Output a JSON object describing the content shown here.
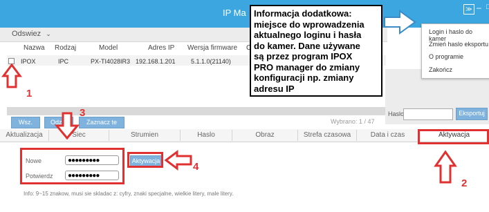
{
  "window": {
    "title": "IP Ma",
    "menu_icon": "chevron-down-double-icon",
    "minimize_glyph": "–",
    "maximize_glyph": "□"
  },
  "toolbar": {
    "refresh_label": "Odswiez"
  },
  "table": {
    "headers": [
      "Nazwa",
      "Rodzaj",
      "Model",
      "Adres IP",
      "Wersja firmware",
      "C"
    ],
    "rows": [
      {
        "name": "IPOX",
        "type": "IPC",
        "model": "PX-TI4028IR3",
        "ip": "192.168.1.201",
        "firmware": "5.1.1.0(21140)"
      }
    ]
  },
  "buttons": {
    "all": "Wsz.",
    "deselect": "Odzn.",
    "select_same": "Zaznacz te same"
  },
  "selection_hint": "Wybrano: 1 / 47",
  "password_label": "Haslo",
  "export_button": "Eksportuj",
  "tabs": [
    "Aktualizacja",
    "Siec",
    "Strumien",
    "Haslo",
    "Obraz",
    "Strefa czasowa",
    "Data i czas",
    "Aktywacja"
  ],
  "activation": {
    "new_label": "Nowe",
    "confirm_label": "Potwierdz",
    "new_value": "●●●●●●●●●",
    "confirm_value": "●●●●●●●●●",
    "button": "Aktywacja",
    "info": "Info: 9~15 znakow, musi sie skladac z: cyfry, znaki specjalne, wielkie litery, male litery."
  },
  "context_menu": {
    "items": [
      "Login i haslo do kamer",
      "Zmień haslo eksportu",
      "O programie",
      "Zakończ"
    ]
  },
  "callout": {
    "lines": [
      "Informacja dodatkowa:",
      "miejsce do wprowadzenia",
      "aktualnego loginu i hasła",
      "do kamer. Dane używane",
      "są przez program IPOX",
      "PRO manager do zmiany",
      "konfiguracji np. zmiany",
      "adresu IP"
    ]
  },
  "annotations": {
    "n1": "1",
    "n2": "2",
    "n3": "3",
    "n4": "4"
  },
  "colors": {
    "titlebar": "#3ba6df",
    "annotation_red": "#e03030",
    "button_blue": "#7fb3dd"
  }
}
